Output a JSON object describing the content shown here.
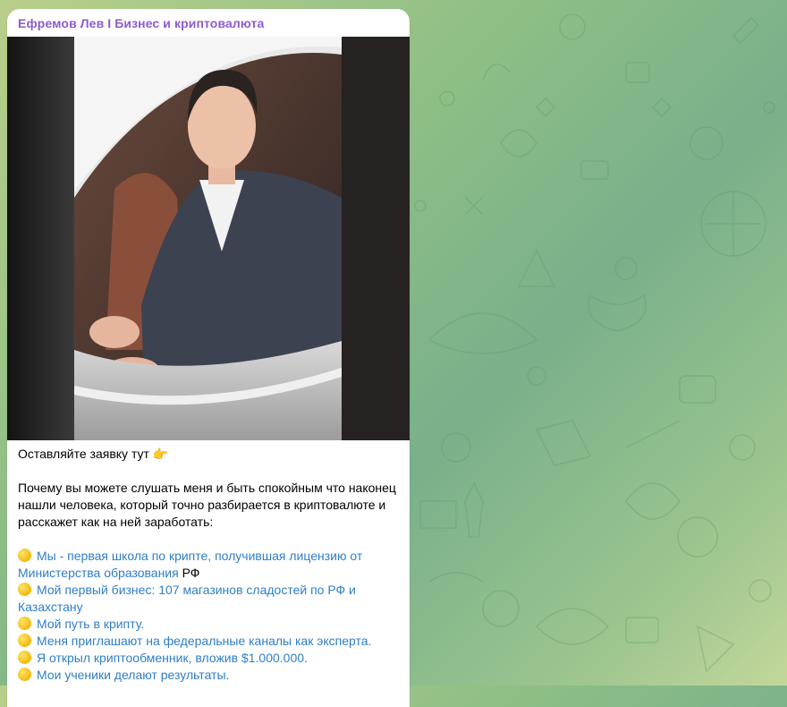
{
  "channel": {
    "name": "Ефремов Лев I Бизнес и криптовалюта"
  },
  "photo": {
    "description_icon": "photo-of-man-in-car"
  },
  "message": {
    "line1": "Оставляйте заявку тут",
    "line1_emoji": "👉",
    "intro": "Почему вы можете слушать меня и быть спокойным что наконец нашли человека, который точно разбирается в криптовалюте и расскажет как на ней заработать:",
    "items": [
      {
        "link": "Мы - первая школа по крипте, получившая лицензию от Министерства образования",
        "tail": " РФ"
      },
      {
        "link": "Мой первый бизнес: 107 магазинов сладостей по РФ и Казахстану",
        "tail": ""
      },
      {
        "link": "Мой путь в крипту.",
        "tail": ""
      },
      {
        "link": "Меня приглашают на федеральные каналы как эксперта.",
        "tail": ""
      },
      {
        "link": "Я открыл криптообменник, вложив $1.000.000.",
        "tail": ""
      },
      {
        "link": "Мои ученики делают результаты.",
        "tail": ""
      }
    ]
  },
  "colors": {
    "channel_name": "#8e5bcf",
    "link": "#2f7ec7",
    "bubble": "#ffffff"
  }
}
